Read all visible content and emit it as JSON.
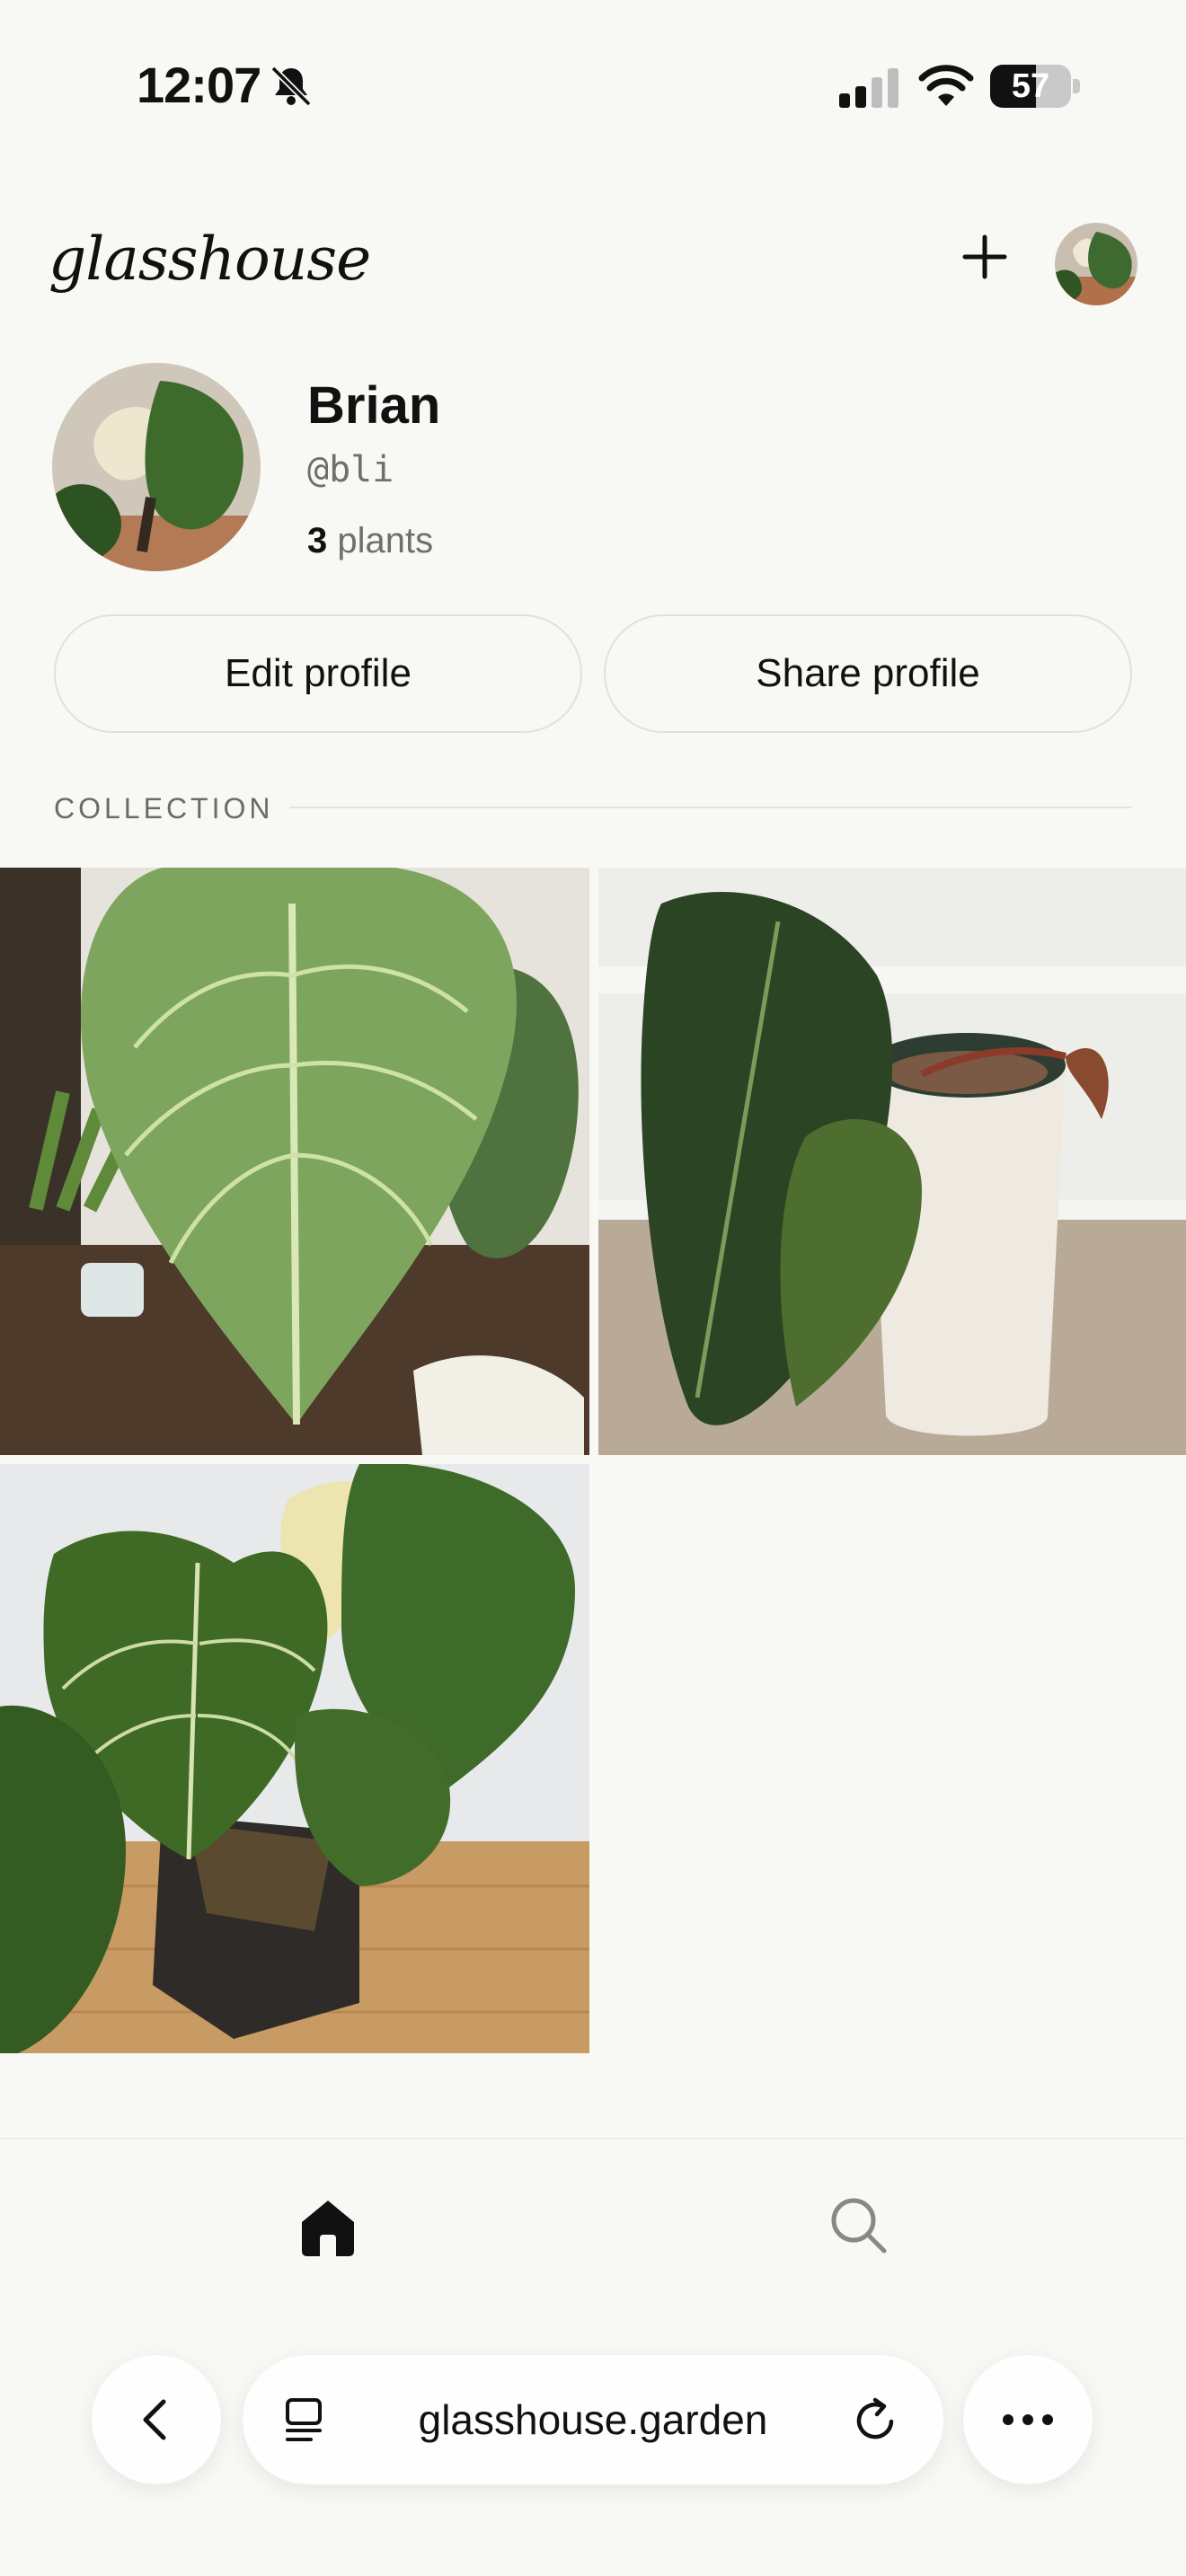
{
  "status": {
    "time": "12:07",
    "battery": "57",
    "battery_level": 0.57
  },
  "header": {
    "logo": "glasshouse"
  },
  "profile": {
    "name": "Brian",
    "handle": "@bli",
    "plant_count": "3",
    "plant_label": "plants",
    "edit_label": "Edit profile",
    "share_label": "Share profile"
  },
  "collection": {
    "label": "COLLECTION"
  },
  "browser": {
    "url": "glasshouse.garden"
  },
  "icons": {
    "bell": "bell-slash-icon",
    "signal": "cellular-signal-icon",
    "wifi": "wifi-icon",
    "plus": "plus-icon",
    "home": "home-icon",
    "search": "search-icon",
    "back": "chevron-left-icon",
    "tabs": "tabs-icon",
    "reload": "reload-icon",
    "more": "ellipsis-icon"
  },
  "colors": {
    "background": "#f8f8f5",
    "text": "#111111",
    "muted": "#6f6f6f",
    "leaf": "#3f5f2a"
  }
}
